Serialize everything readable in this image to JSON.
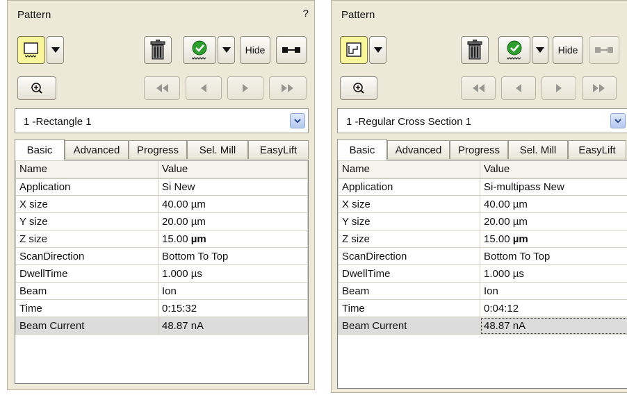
{
  "panels": [
    {
      "title": "Pattern",
      "help": "?",
      "hide_label": "Hide",
      "combo_value": "1 -Rectangle 1",
      "tabs": [
        "Basic",
        "Advanced",
        "Progress",
        "Sel. Mill",
        "EasyLift"
      ],
      "grid_header": [
        "Name",
        "Value"
      ],
      "rows": [
        [
          "Application",
          "Si New"
        ],
        [
          "X size",
          "40.00 µm"
        ],
        [
          "Y size",
          "20.00 µm"
        ],
        [
          "Z size",
          "15.00 "
        ],
        [
          "ScanDirection",
          "Bottom To Top"
        ],
        [
          "DwellTime",
          "1.000 µs"
        ],
        [
          "Beam",
          "Ion"
        ],
        [
          "Time",
          "0:15:32"
        ],
        [
          "Beam Current",
          "48.87 nA"
        ]
      ],
      "z_unit_bold": "µm"
    },
    {
      "title": "Pattern",
      "help": "?",
      "hide_label": "Hide",
      "combo_value": "1 -Regular Cross Section 1",
      "tabs": [
        "Basic",
        "Advanced",
        "Progress",
        "Sel. Mill",
        "EasyLift"
      ],
      "grid_header": [
        "Name",
        "Value"
      ],
      "rows": [
        [
          "Application",
          "Si-multipass New"
        ],
        [
          "X size",
          "40.00 µm"
        ],
        [
          "Y size",
          "20.00 µm"
        ],
        [
          "Z size",
          "15.00 "
        ],
        [
          "ScanDirection",
          "Bottom To Top"
        ],
        [
          "DwellTime",
          "1.000 µs"
        ],
        [
          "Beam",
          "Ion"
        ],
        [
          "Time",
          "0:04:12"
        ],
        [
          "Beam Current",
          "48.87 nA"
        ]
      ],
      "z_unit_bold": "µm"
    }
  ],
  "colors": {
    "panel_bg": "#ece9d8",
    "pattern_button": "#f9f59a",
    "selected_row": "#dcdcdc",
    "check_icon": "#2e9e2e"
  }
}
